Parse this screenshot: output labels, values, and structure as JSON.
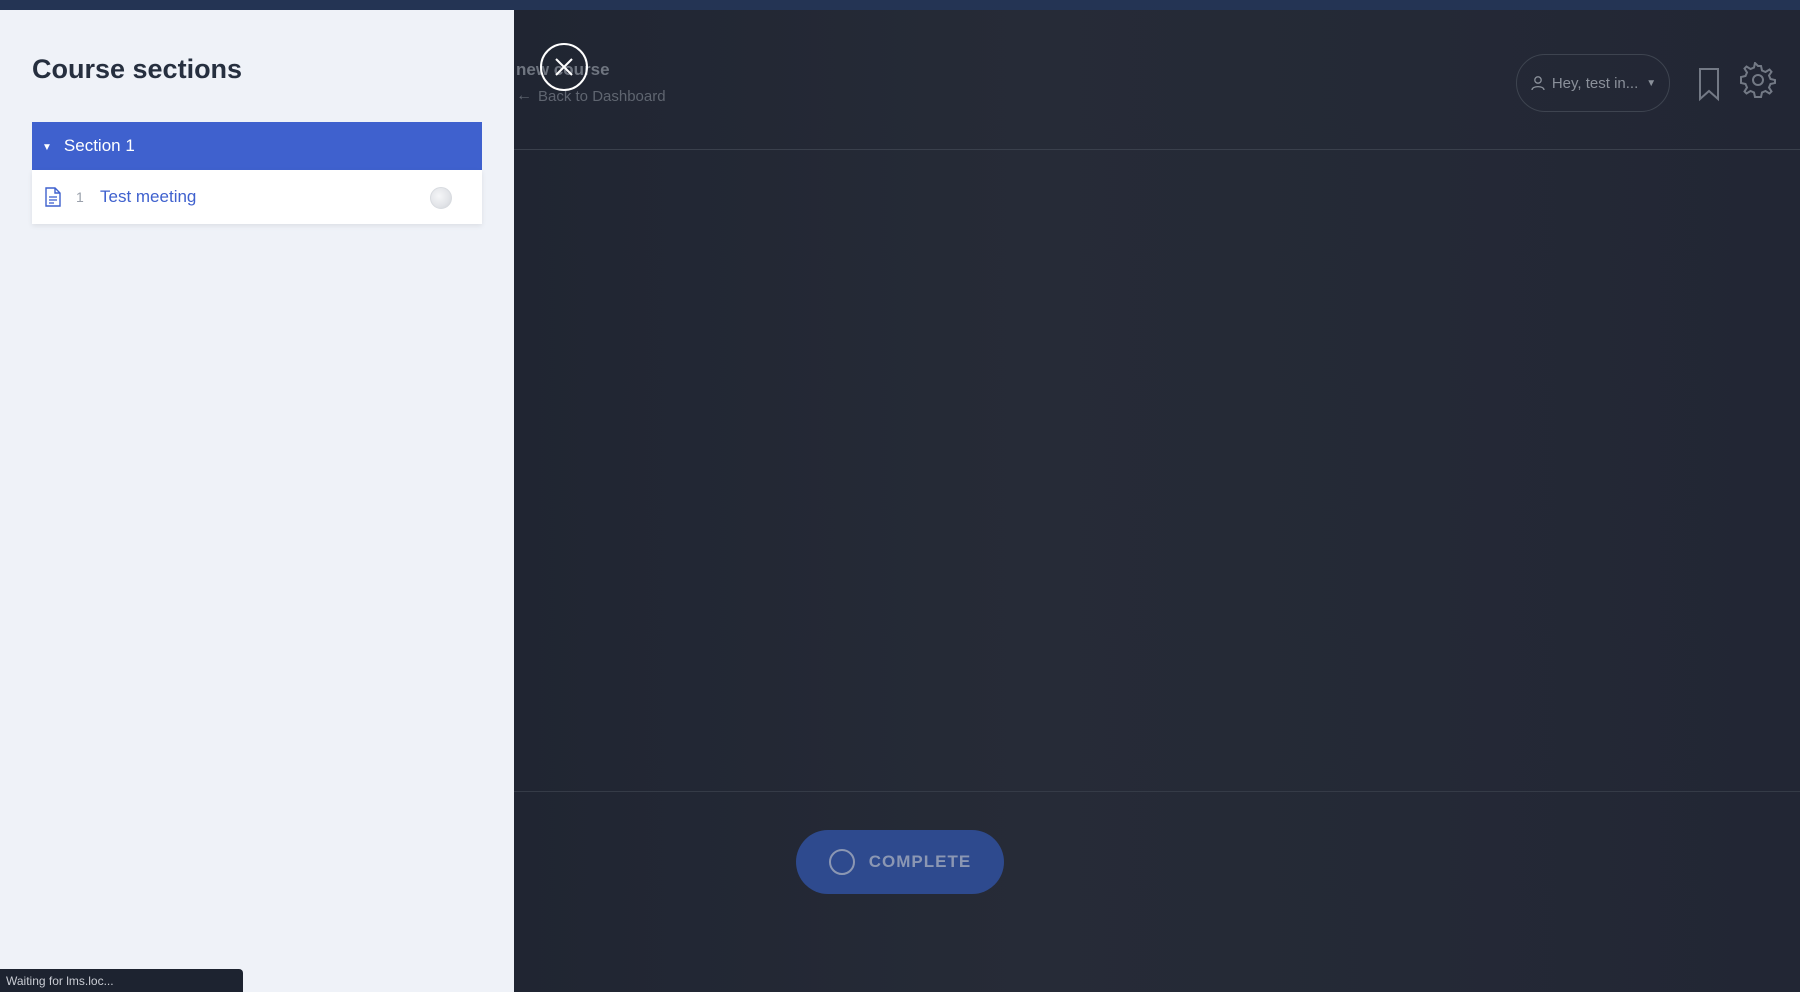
{
  "sidebar": {
    "title": "Course sections",
    "section": {
      "label": "Section 1"
    },
    "lessons": [
      {
        "number": "1",
        "title": "Test meeting"
      }
    ]
  },
  "header": {
    "course_title": "new course",
    "back_link": "Back to Dashboard",
    "user_greeting": "Hey, test in..."
  },
  "footer": {
    "complete_label": "COMPLETE"
  },
  "status_bar": {
    "text": "Waiting for lms.loc..."
  },
  "icons": {
    "close": "close-icon",
    "bookmark": "bookmark-icon",
    "settings": "gear-icon",
    "user": "user-icon",
    "document": "document-icon"
  },
  "colors": {
    "accent": "#3f61ce",
    "sidebar_bg": "#eff2f8",
    "overlay_bg": "#252a36"
  }
}
